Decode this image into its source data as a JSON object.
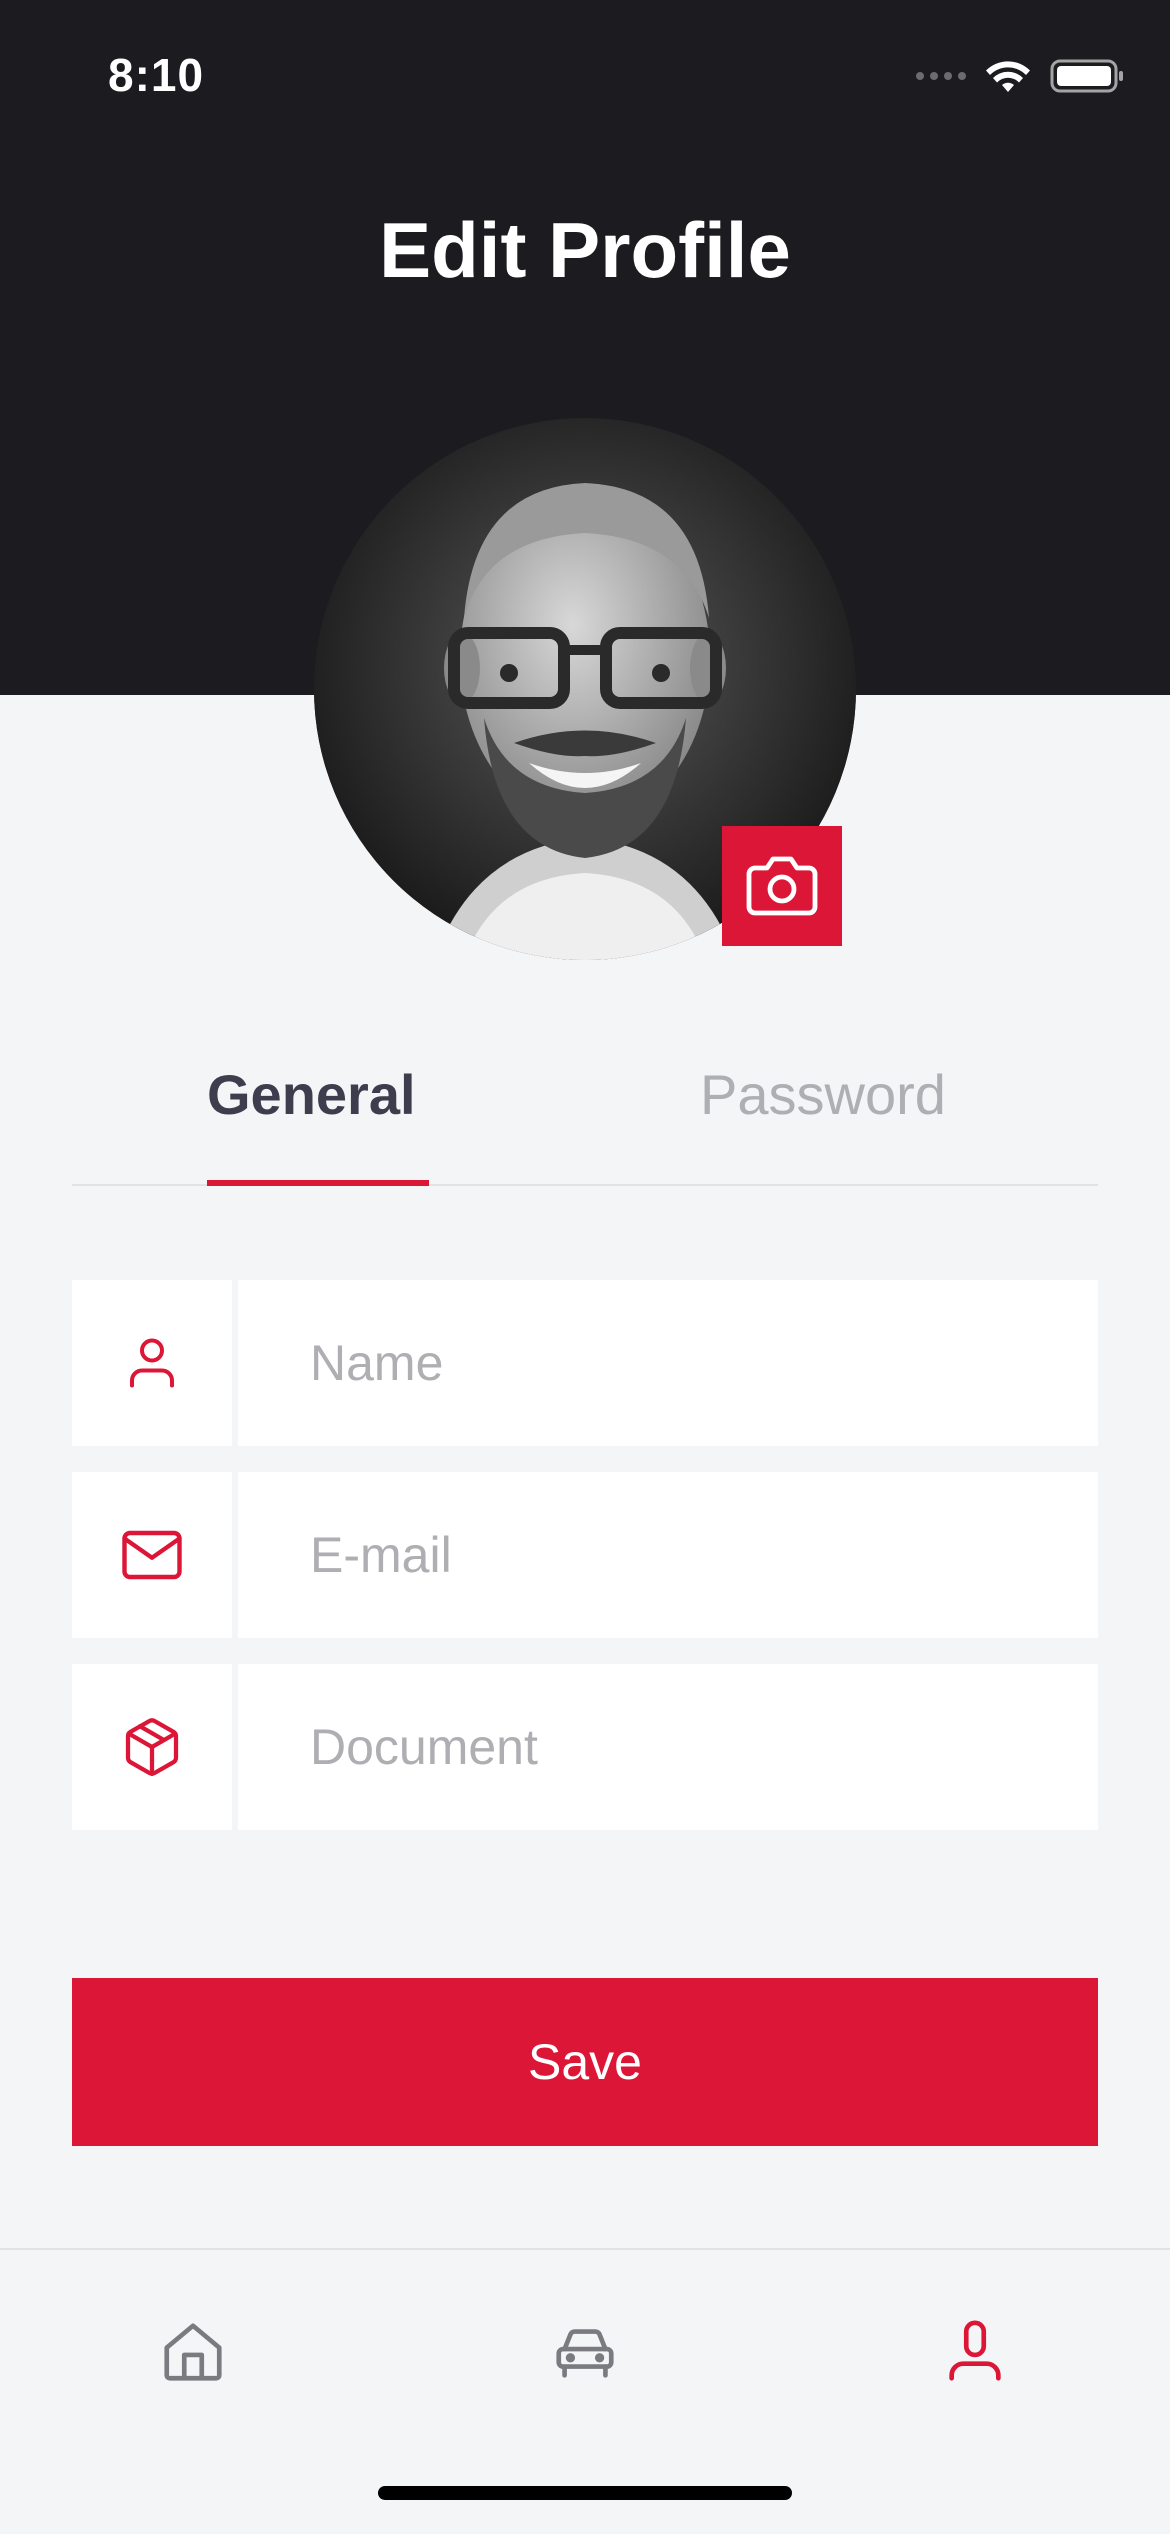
{
  "status_bar": {
    "time": "8:10"
  },
  "header": {
    "title": "Edit Profile"
  },
  "avatar": {
    "alt": "Profile photo"
  },
  "tabs": [
    {
      "label": "General",
      "active": true
    },
    {
      "label": "Password",
      "active": false
    }
  ],
  "form": {
    "name": {
      "placeholder": "Name",
      "value": "",
      "icon": "user-icon"
    },
    "email": {
      "placeholder": "E-mail",
      "value": "",
      "icon": "mail-icon"
    },
    "document": {
      "placeholder": "Document",
      "value": "",
      "icon": "box-icon"
    }
  },
  "save_button": {
    "label": "Save"
  },
  "bottom_nav": [
    {
      "icon": "home-icon",
      "active": false
    },
    {
      "icon": "car-icon",
      "active": false
    },
    {
      "icon": "user-icon",
      "active": true
    }
  ],
  "colors": {
    "accent": "#DC1637",
    "header_bg": "#1C1C20",
    "background": "#F4F5F7",
    "text_primary": "#3D3D4D",
    "text_muted": "#AEAEB3"
  }
}
